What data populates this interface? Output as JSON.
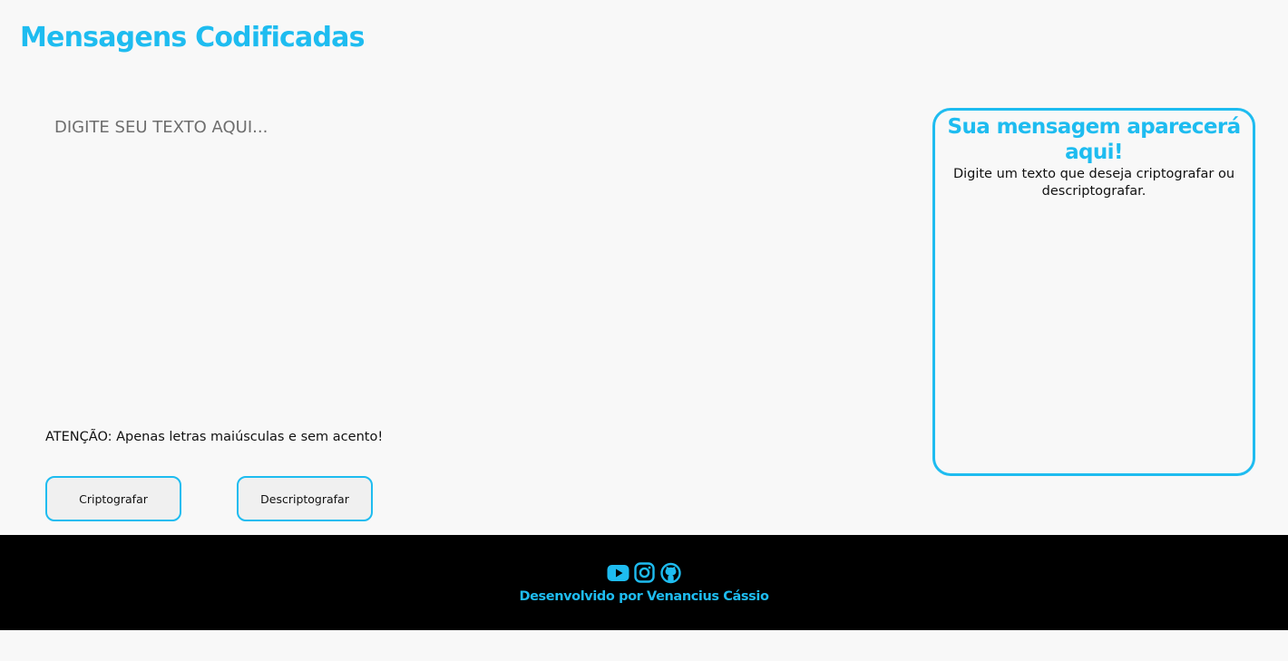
{
  "header": {
    "title": "Mensagens Codificadas"
  },
  "input": {
    "placeholder": "DIGITE SEU TEXTO AQUI...",
    "value": ""
  },
  "warning": "ATENÇÃO: Apenas letras maiúsculas e sem acento!",
  "buttons": {
    "encrypt_label": "Criptografar",
    "decrypt_label": "Descriptografar"
  },
  "output": {
    "title": "Sua mensagem aparecerá aqui!",
    "text": "Digite um texto que deseja criptografar ou descriptografar."
  },
  "footer": {
    "icons": [
      "youtube-icon",
      "instagram-icon",
      "github-icon"
    ],
    "credit": "Desenvolvido por Venancius Cássio"
  },
  "colors": {
    "accent": "#1ebcf0",
    "background": "#f8f8f8",
    "footer_background": "#000000"
  }
}
